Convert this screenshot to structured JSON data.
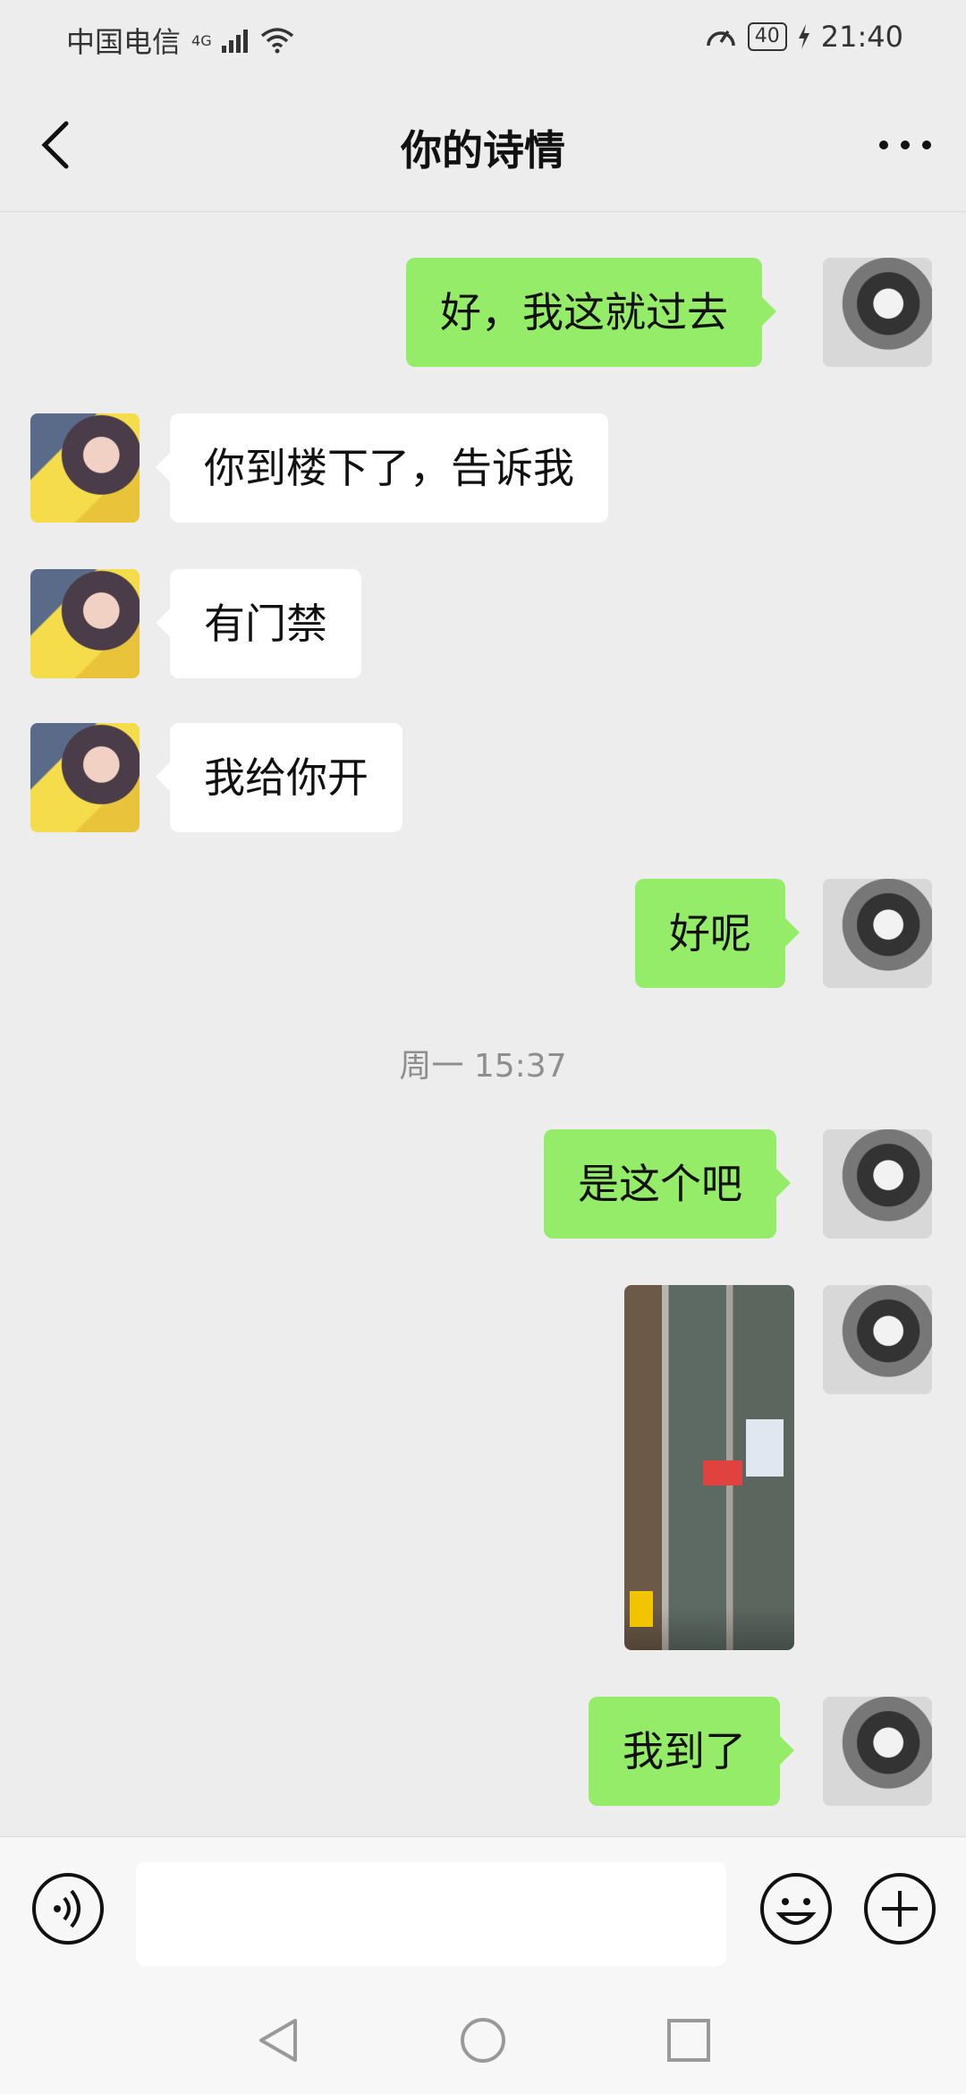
{
  "status_bar": {
    "carrier": "中国电信",
    "network": "4G",
    "battery": "40",
    "time": "21:40"
  },
  "header": {
    "title": "你的诗情"
  },
  "messages": [
    {
      "side": "right",
      "text": "好，我这就过去"
    },
    {
      "side": "left",
      "text": "你到楼下了，告诉我"
    },
    {
      "side": "left",
      "text": "有门禁"
    },
    {
      "side": "left",
      "text": "我给你开"
    },
    {
      "side": "right",
      "text": "好呢"
    },
    {
      "side": "right",
      "text": "是这个吧"
    },
    {
      "side": "right",
      "type": "image"
    },
    {
      "side": "right",
      "text": "我到了"
    }
  ],
  "timestamp": "周一 15:37",
  "input": {
    "placeholder": ""
  },
  "icons": {
    "back": "back-chevron-icon",
    "more": "more-dots-icon",
    "voice": "voice-icon",
    "emoji": "emoji-icon",
    "plus": "plus-icon"
  },
  "colors": {
    "sent_bubble": "#95ec69",
    "received_bubble": "#ffffff",
    "background": "#ededed"
  }
}
